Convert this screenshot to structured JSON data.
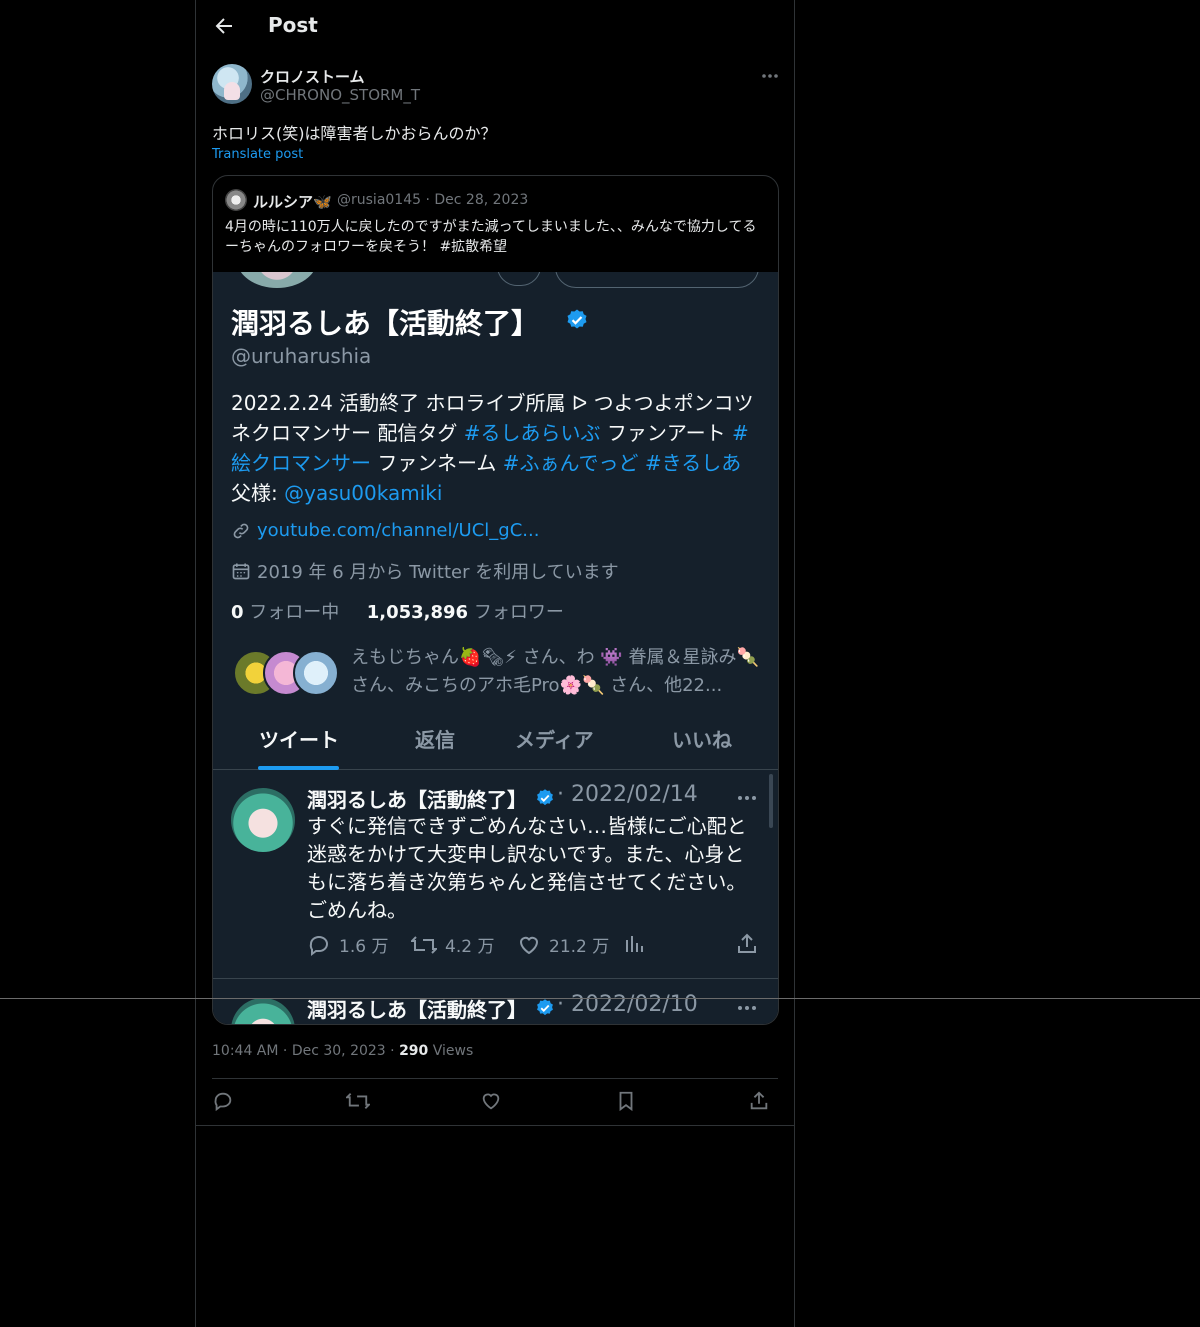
{
  "header": {
    "title": "Post"
  },
  "post": {
    "author_name": "クロノストーム",
    "author_handle": "@CHRONO_STORM_T",
    "text": "ホロリス(笑)は障害者しかおらんのか？",
    "translate_label": "Translate post",
    "time": "10:44 AM",
    "date": "Dec 30, 2023",
    "views_count": "290",
    "views_label": "Views"
  },
  "quote": {
    "author_name": "ルルシア🦋",
    "author_handle": "@rusia0145",
    "date": "Dec 28, 2023",
    "text": "4月の時に110万人に戻したのですがまた減ってしまいました、、みんなで協力してるーちゃんのフォロワーを戻そう！ #拡散希望"
  },
  "screenshot": {
    "profile_name": "潤羽るしあ【活動終了】",
    "profile_handle": "@uruharushia",
    "bio_parts": {
      "p1": "2022.2.24 活動終了 ホロライブ所属 ᐅ つよつよポンコツネクロマンサー 配信タグ ",
      "h1": "#るしあらいぶ",
      "p2": " ファンアート ",
      "h2": "#絵クロマンサー",
      "p3": " ファンネーム ",
      "h3": "#ふぁんでっど",
      "p4": " ",
      "h4": "#きるしあ",
      "p5": " 父様: ",
      "h5": "@yasu00kamiki"
    },
    "link": "youtube.com/channel/UCl_gC...",
    "joined": "2019 年 6 月から Twitter を利用しています",
    "following_count": "0",
    "following_label": "フォロー中",
    "followers_count": "1,053,896",
    "followers_label": "フォロワー",
    "followed_by": "えもじちゃん🍓🗞⚡ さん、わ 👾 眷属＆星詠み🍡 さん、みこちのアホ毛Pro🌸🍡 さん、他22...",
    "tabs": [
      "ツイート",
      "返信",
      "メディア",
      "いいね"
    ],
    "tweets": [
      {
        "name": "潤羽るしあ【活動終了】",
        "date": "· 2022/02/14",
        "text": "すぐに発信できずごめんなさい…皆様にご心配と迷惑をかけて大変申し訳ないです。また、心身ともに落ち着き次第ちゃんと発信させてください。ごめんね。",
        "replies": "1.6 万",
        "retweets": "4.2 万",
        "likes": "21.2 万"
      },
      {
        "name": "潤羽るしあ【活動終了】",
        "date": "· 2022/02/10"
      }
    ]
  },
  "colors": {
    "accent": "#1d9bf0",
    "background": "#000000",
    "screenshot_bg": "#15202b"
  },
  "icons": [
    "back-arrow-icon",
    "more-icon",
    "verified-icon",
    "link-icon",
    "calendar-icon",
    "reply-icon",
    "retweet-icon",
    "like-icon",
    "views-icon",
    "share-icon",
    "bookmark-icon"
  ]
}
